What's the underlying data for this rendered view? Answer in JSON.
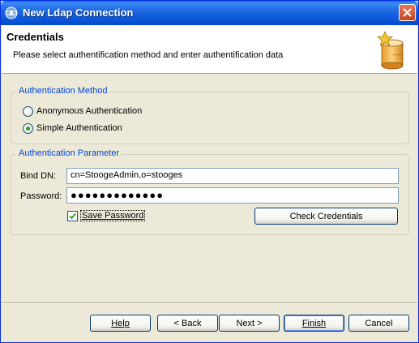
{
  "window": {
    "title": "New Ldap Connection"
  },
  "header": {
    "title": "Credentials",
    "description": "Please select authentification method and enter authentification data"
  },
  "auth_method": {
    "legend": "Authentication Method",
    "options": [
      {
        "label": "Anonymous Authentication",
        "selected": false
      },
      {
        "label": "Simple Authentication",
        "selected": true
      }
    ]
  },
  "auth_param": {
    "legend": "Authentication Parameter",
    "bind_dn_label": "Bind DN:",
    "bind_dn_value": "cn=StoogeAdmin,o=stooges",
    "password_label": "Password:",
    "password_value": "●●●●●●●●●●●●●",
    "save_password_label": "Save Password",
    "save_password_checked": true,
    "check_credentials_label": "Check Credentials"
  },
  "footer": {
    "help_label": "Help",
    "back_label": "< Back",
    "next_label": "Next >",
    "finish_label": "Finish",
    "cancel_label": "Cancel"
  },
  "colors": {
    "titlebar": "#0553d6",
    "legend_text": "#0046d5",
    "dialog_bg": "#ece9d8"
  }
}
